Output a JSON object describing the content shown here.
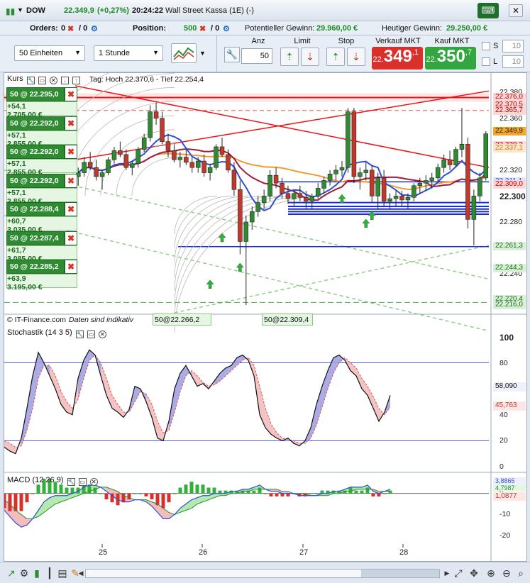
{
  "title": {
    "symbol": "DOW",
    "price": "22.349,9",
    "change": "(+0,27%)",
    "time": "20:24:22",
    "name": "Wall Street Kassa (1E) (-)"
  },
  "info": {
    "orders_label": "Orders:",
    "orders_val": "0",
    "orders_sep": "/ 0",
    "position_label": "Position:",
    "position_val": "500",
    "position_sep": "/ 0",
    "potential_label": "Potentieller Gewinn:",
    "potential_val": "29.960,00 €",
    "today_label": "Heutiger Gewinn:",
    "today_val": "29.250,00 €"
  },
  "toolbar": {
    "units": "50 Einheiten",
    "period": "1 Stunde",
    "anz_label": "Anz",
    "anz_value": "50",
    "limit_label": "Limit",
    "stop_label": "Stop",
    "sell_label": "Verkauf MKT",
    "buy_label": "Kauf MKT",
    "sell_price_small": "22.",
    "sell_price_big": "349",
    "sell_price_sup": ",1",
    "buy_price_small": "22.",
    "buy_price_big": "350",
    "buy_price_sup": ",7",
    "s_label": "S",
    "l_label": "L",
    "s_value": "10",
    "l_value": "10"
  },
  "colors": {
    "up": "#2e8b32",
    "down": "#c0392b",
    "sell": "#d9302c",
    "buy": "#33a640",
    "ma_red": "#a31a3a",
    "ma_blue": "#2d4fd6",
    "ma_orange": "#f39a33"
  },
  "price_panel": {
    "header": "Kurs",
    "daily_range": "Tag: Hoch 22.370,6 - Tief 22.254,4",
    "footer": "© IT-Finance.com",
    "footer_note": "Daten sind indikativ",
    "entry_a": "50@22.266,2",
    "entry_b": "50@22.309,4",
    "y_labels": [
      "22.380",
      "22.360",
      "22.340",
      "22.320",
      "22.300",
      "22.280",
      "22.260",
      "22.240",
      "22.220"
    ],
    "y_label_bold": "22.300",
    "price_tags": [
      {
        "text": "22.376,0",
        "bg": "#ffd6d6",
        "color": "#b00"
      },
      {
        "text": "22.370,5",
        "bg": "#ffd6d6",
        "color": "#b00"
      },
      {
        "text": "22.365,7",
        "bg": "#ffd6d6",
        "color": "#b00"
      },
      {
        "text": "22.349,9",
        "bg": "#f5a623",
        "color": "#222"
      },
      {
        "text": "22.339,2",
        "bg": "#ffd6d6",
        "color": "#b00"
      },
      {
        "text": "22.337,1",
        "bg": "#fde6cc",
        "color": "#c57a1a"
      },
      {
        "text": "22.311,1",
        "bg": "#dde6ff",
        "color": "#2d4fd6"
      },
      {
        "text": "22.309,0",
        "bg": "#ffd6d6",
        "color": "#b00"
      },
      {
        "text": "22.261,3",
        "bg": "#d8f0d5",
        "color": "#1b6b1e"
      },
      {
        "text": "22.244,3",
        "bg": "#d8f0d5",
        "color": "#1b6b1e"
      },
      {
        "text": "22.220,4",
        "bg": "#d8f0d5",
        "color": "#1b6b1e"
      },
      {
        "text": "22.216,0",
        "bg": "#d8f0d5",
        "color": "#1b6b1e"
      }
    ],
    "orders": [
      {
        "label": "50 @ 22.295,0",
        "pl": "+54,1",
        "amount": "2.705,00 €"
      },
      {
        "label": "50 @ 22.292,0",
        "pl": "+57,1",
        "amount": "2.855,00 €"
      },
      {
        "label": "50 @ 22.292,0",
        "pl": "+57,1",
        "amount": "2.855,00 €"
      },
      {
        "label": "50 @ 22.292,0",
        "pl": "+57,1",
        "amount": "2.855,00 €"
      },
      {
        "label": "50 @ 22.288,4",
        "pl": "+60,7",
        "amount": "3.035,00 €"
      },
      {
        "label": "50 @ 22.287,4",
        "pl": "+61,7",
        "amount": "3.085,00 €"
      },
      {
        "label": "50 @ 22.285,2",
        "pl": "+63,9",
        "amount": "3.195,00 €"
      }
    ]
  },
  "stoch_panel": {
    "header": "Stochastik (14 3 5)",
    "y_labels": [
      "100",
      "80",
      "60",
      "40",
      "20",
      "0"
    ],
    "tag1": "58,090",
    "tag2": "45,763"
  },
  "macd_panel": {
    "header": "MACD (12 26 9)",
    "y_labels": [
      "0",
      "-10",
      "-20"
    ],
    "tag1": "3,8865",
    "tag2": "4,7987",
    "tag3": "1,0877"
  },
  "x_labels": [
    "25",
    "26",
    "27",
    "28"
  ],
  "chart_data": {
    "type": "line",
    "title": "Kurs",
    "ylim": [
      22210,
      22385
    ],
    "candles": [
      [
        22315,
        22322,
        22308,
        22318
      ],
      [
        22318,
        22330,
        22315,
        22326
      ],
      [
        22326,
        22334,
        22320,
        22322
      ],
      [
        22322,
        22328,
        22312,
        22315
      ],
      [
        22315,
        22320,
        22305,
        22318
      ],
      [
        22318,
        22330,
        22316,
        22328
      ],
      [
        22328,
        22338,
        22325,
        22335
      ],
      [
        22335,
        22342,
        22330,
        22332
      ],
      [
        22332,
        22336,
        22320,
        22322
      ],
      [
        22322,
        22327,
        22316,
        22325
      ],
      [
        22325,
        22338,
        22322,
        22336
      ],
      [
        22336,
        22348,
        22334,
        22345
      ],
      [
        22345,
        22370,
        22342,
        22365
      ],
      [
        22365,
        22372,
        22355,
        22360
      ],
      [
        22360,
        22365,
        22340,
        22342
      ],
      [
        22342,
        22348,
        22330,
        22335
      ],
      [
        22335,
        22340,
        22326,
        22328
      ],
      [
        22328,
        22334,
        22322,
        22330
      ],
      [
        22330,
        22336,
        22324,
        22326
      ],
      [
        22326,
        22330,
        22318,
        22322
      ],
      [
        22322,
        22330,
        22318,
        22327
      ],
      [
        22327,
        22332,
        22315,
        22318
      ],
      [
        22318,
        22325,
        22312,
        22322
      ],
      [
        22322,
        22340,
        22320,
        22338
      ],
      [
        22338,
        22345,
        22330,
        22332
      ],
      [
        22332,
        22336,
        22318,
        22320
      ],
      [
        22320,
        22326,
        22300,
        22305
      ],
      [
        22305,
        22312,
        22255,
        22265
      ],
      [
        22265,
        22285,
        22216,
        22280
      ],
      [
        22280,
        22292,
        22274,
        22288
      ],
      [
        22288,
        22300,
        22284,
        22295
      ],
      [
        22295,
        22305,
        22290,
        22300
      ],
      [
        22300,
        22320,
        22296,
        22316
      ],
      [
        22316,
        22322,
        22306,
        22310
      ],
      [
        22310,
        22314,
        22298,
        22302
      ],
      [
        22302,
        22308,
        22294,
        22298
      ],
      [
        22298,
        22305,
        22292,
        22302
      ],
      [
        22302,
        22308,
        22296,
        22299
      ],
      [
        22299,
        22304,
        22290,
        22296
      ],
      [
        22296,
        22302,
        22290,
        22300
      ],
      [
        22300,
        22310,
        22298,
        22306
      ],
      [
        22306,
        22315,
        22302,
        22312
      ],
      [
        22312,
        22320,
        22308,
        22317
      ],
      [
        22317,
        22324,
        22312,
        22320
      ],
      [
        22320,
        22327,
        22315,
        22322
      ],
      [
        22322,
        22368,
        22318,
        22365
      ],
      [
        22365,
        22368,
        22310,
        22315
      ],
      [
        22315,
        22322,
        22305,
        22318
      ],
      [
        22318,
        22326,
        22312,
        22320
      ],
      [
        22320,
        22324,
        22295,
        22300
      ],
      [
        22300,
        22318,
        22290,
        22314
      ],
      [
        22314,
        22320,
        22292,
        22296
      ],
      [
        22296,
        22302,
        22290,
        22298
      ],
      [
        22298,
        22304,
        22292,
        22300
      ],
      [
        22300,
        22304,
        22292,
        22297
      ],
      [
        22297,
        22302,
        22290,
        22299
      ],
      [
        22299,
        22310,
        22296,
        22308
      ],
      [
        22308,
        22314,
        22302,
        22310
      ],
      [
        22310,
        22316,
        22304,
        22312
      ],
      [
        22312,
        22318,
        22306,
        22314
      ],
      [
        22314,
        22325,
        22310,
        22322
      ],
      [
        22322,
        22332,
        22318,
        22328
      ],
      [
        22328,
        22335,
        22320,
        22324
      ],
      [
        22324,
        22338,
        22322,
        22336
      ],
      [
        22336,
        22368,
        22330,
        22340
      ],
      [
        22340,
        22345,
        22275,
        22282
      ],
      [
        22282,
        22305,
        22262,
        22300
      ],
      [
        22300,
        22318,
        22296,
        22314
      ],
      [
        22314,
        22350,
        22312,
        22348
      ]
    ],
    "stochastic_k": [
      15,
      12,
      10,
      22,
      45,
      70,
      88,
      80,
      70,
      60,
      48,
      42,
      40,
      68,
      82,
      90,
      86,
      70,
      55,
      45,
      42,
      38,
      44,
      62,
      60,
      50,
      38,
      22,
      20,
      35,
      60,
      72,
      78,
      70,
      62,
      64,
      60,
      66,
      72,
      76,
      78,
      84,
      86,
      82,
      70,
      40,
      30,
      25,
      22,
      20,
      22,
      18,
      16,
      20,
      30,
      48,
      62,
      74,
      84,
      86,
      82,
      74,
      70,
      60,
      55,
      45,
      35,
      42,
      55
    ],
    "stochastic_d": [
      20,
      18,
      15,
      16,
      28,
      45,
      68,
      78,
      78,
      70,
      58,
      50,
      45,
      52,
      68,
      82,
      86,
      80,
      68,
      55,
      48,
      42,
      42,
      50,
      58,
      56,
      48,
      35,
      26,
      28,
      42,
      58,
      70,
      74,
      70,
      65,
      62,
      63,
      66,
      70,
      74,
      78,
      82,
      84,
      78,
      62,
      45,
      33,
      26,
      22,
      21,
      20,
      18,
      18,
      22,
      32,
      46,
      60,
      72,
      80,
      84,
      80,
      76,
      68,
      62,
      54,
      45,
      40,
      46
    ],
    "macd": [
      -8,
      -11,
      -14,
      -16,
      -15,
      -12,
      -8,
      -4,
      -2,
      -1,
      -1,
      -1,
      0,
      1,
      3,
      4,
      4,
      3,
      1,
      -1,
      -3,
      -4,
      -4,
      -3,
      -3,
      -4,
      -6,
      -9,
      -12,
      -12,
      -10,
      -7,
      -5,
      -3,
      -2,
      -1,
      -1,
      0,
      0,
      0,
      1,
      1,
      2,
      2,
      3,
      4,
      2,
      1,
      1,
      0,
      0,
      0,
      -1,
      -1,
      -1,
      -1,
      0,
      0,
      1,
      1,
      2,
      3,
      3,
      3,
      4,
      1,
      0,
      1,
      2
    ],
    "macd_signal": [
      -3,
      -5,
      -8,
      -10,
      -12,
      -12,
      -11,
      -9,
      -7,
      -5,
      -4,
      -3,
      -2,
      -1,
      0,
      1,
      2,
      3,
      3,
      2,
      1,
      -1,
      -2,
      -3,
      -3,
      -3,
      -4,
      -5,
      -7,
      -9,
      -10,
      -9,
      -8,
      -7,
      -5,
      -4,
      -3,
      -2,
      -1,
      -1,
      0,
      0,
      1,
      1,
      2,
      2,
      2,
      2,
      2,
      1,
      1,
      0,
      0,
      0,
      -1,
      -1,
      -1,
      -1,
      0,
      0,
      1,
      1,
      2,
      2,
      2,
      2,
      1,
      1,
      1
    ]
  }
}
